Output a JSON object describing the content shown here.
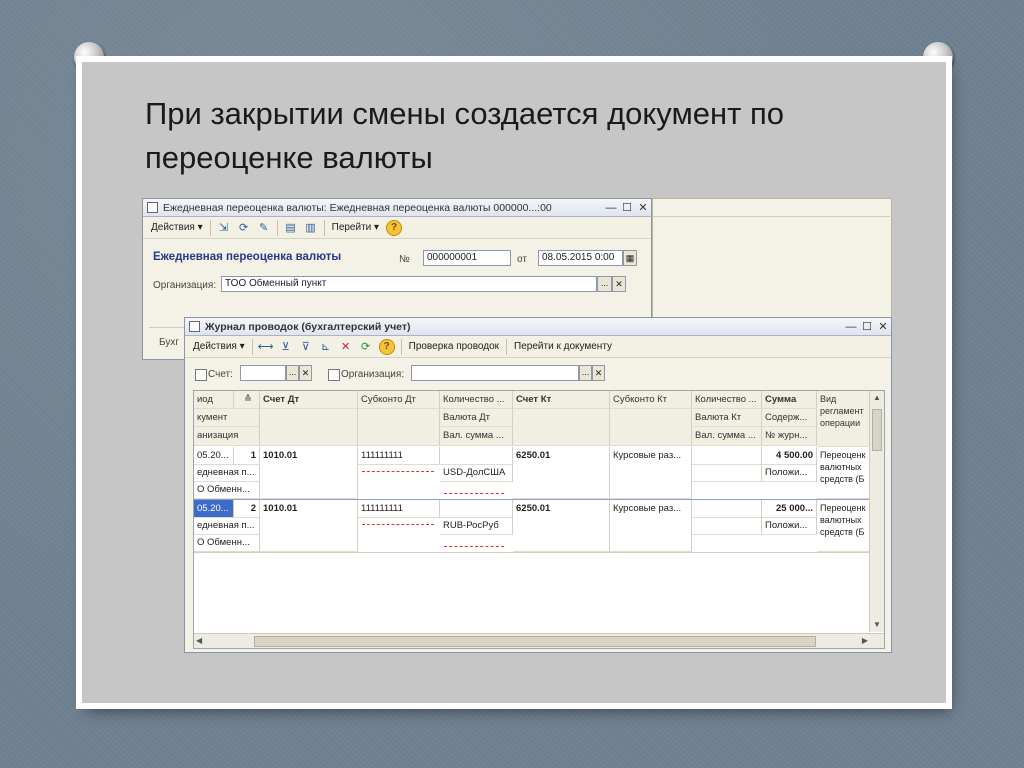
{
  "slide": {
    "title": "При закрытии смены создается документ по переоценке валюты"
  },
  "doc_window": {
    "title": "Ежедневная переоценка валюты: Ежедневная переоценка валюты 000000...:00",
    "toolbar": {
      "actions": "Действия ▾",
      "goto": "Перейти ▾"
    },
    "heading": "Ежедневная переоценка валюты",
    "number_label": "№",
    "number_value": "000000001",
    "date_label": "от",
    "date_value": "08.05.2015 0:00",
    "org_label": "Организация:",
    "org_value": "ТОО Обменный пункт",
    "footer_partial": "Бухг"
  },
  "journal_window": {
    "title": "Журнал проводок (бухгалтерский учет)",
    "toolbar": {
      "actions": "Действия ▾",
      "check": "Проверка проводок",
      "goto_doc": "Перейти к документу"
    },
    "filter": {
      "account_label": "Счет:",
      "account_value": "",
      "org_label": "Организация:",
      "org_value": ""
    },
    "headers": {
      "period": "иод",
      "document": "кумент",
      "org": "анизация",
      "dt": "Счет Дт",
      "subk_dt": "Субконто Дт",
      "qty_dt": "Количество ...",
      "val_dt": "Валюта Дт",
      "valsum_dt": "Вал. сумма ...",
      "kt": "Счет Кт",
      "subk_kt": "Субконто Кт",
      "qty_kt": "Количество ...",
      "val_kt": "Валюта Кт",
      "valsum_kt": "Вал. сумма ...",
      "sum": "Сумма",
      "content": "Содерж...",
      "journal": "№ журн...",
      "op_type": "Вид регламент операции"
    },
    "rows": [
      {
        "period": "05.20...",
        "num": "1",
        "doc": "едневная п...",
        "org": "О Обменн...",
        "dt": "1010.01",
        "subk_dt": "111111111",
        "currency": "USD-ДолСША",
        "kt": "6250.01",
        "subk_kt": "Курсовые раз...",
        "sum": "4 500.00",
        "content": "Положи...",
        "op": "Переоценк валютных средств (Б"
      },
      {
        "period": "05.20...",
        "num": "2",
        "doc": "едневная п...",
        "org": "О Обменн...",
        "dt": "1010.01",
        "subk_dt": "111111111",
        "currency": "RUB-РосРуб",
        "kt": "6250.01",
        "subk_kt": "Курсовые раз...",
        "sum": "25 000...",
        "content": "Положи...",
        "op": "Переоценк валютных средств (Б"
      }
    ]
  }
}
